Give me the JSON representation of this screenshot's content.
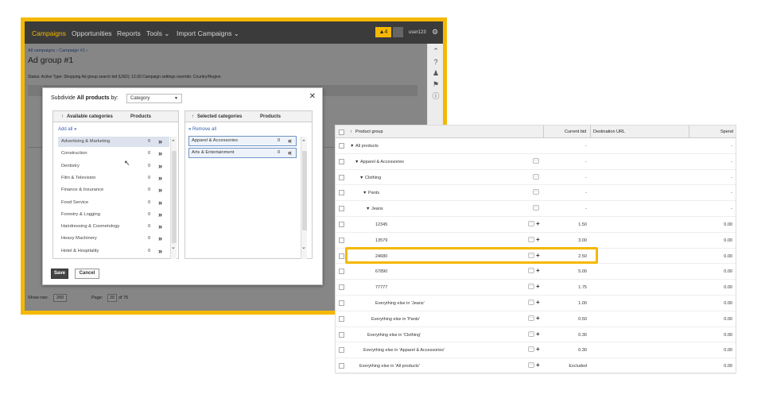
{
  "app": {
    "nav": [
      "Campaigns",
      "Opportunities",
      "Reports",
      "Tools ⌄",
      "Import Campaigns ⌄"
    ],
    "warning_count": "4",
    "user": "user123",
    "breadcrumb": "All campaigns › Campaign #1 ›",
    "page_title": "Ad group #1",
    "status_line": "Status: Active   Type: Shopping   Ad group search bid (USD): 12.00   Campaign settings override: Country/Region",
    "show_rows_label": "Show row:",
    "show_rows_value": "200",
    "page_label": "Page:",
    "page_value": "20",
    "page_of": "of 75"
  },
  "dialog": {
    "title_prefix": "Subdivide",
    "title_bold": "All products",
    "title_suffix": "by:",
    "dropdown_value": "Category",
    "available_header": "Available categories",
    "products_header": "Products",
    "add_all": "Add all",
    "available": [
      {
        "name": "Advertising & Marketing",
        "count": "0"
      },
      {
        "name": "Construction",
        "count": "0"
      },
      {
        "name": "Dentistry",
        "count": "0"
      },
      {
        "name": "Film & Television",
        "count": "0"
      },
      {
        "name": "Finance & Insurance",
        "count": "0"
      },
      {
        "name": "Food Service",
        "count": "0"
      },
      {
        "name": "Forestry & Logging",
        "count": "0"
      },
      {
        "name": "Hairdressing & Cosmetology",
        "count": "0"
      },
      {
        "name": "Heavy Machinery",
        "count": "0"
      },
      {
        "name": "Hotel & Hospitality",
        "count": "0"
      }
    ],
    "selected_header": "Selected categories",
    "remove_all": "Remove all",
    "selected": [
      {
        "name": "Apparel & Accessories",
        "count": "0"
      },
      {
        "name": "Arts & Entertainment",
        "count": "0"
      }
    ],
    "save": "Save",
    "cancel": "Cancel"
  },
  "table": {
    "headers": {
      "product_group": "Product group",
      "current_bid": "Current bid",
      "destination_url": "Destination URL",
      "spend": "Spend"
    },
    "rows": [
      {
        "group": "All products",
        "bid": "-",
        "spend": "-"
      },
      {
        "group": "Apparel & Accessories",
        "bid": "-",
        "spend": "-"
      },
      {
        "group": "Clothing",
        "bid": "-",
        "spend": "-"
      },
      {
        "group": "Pants",
        "bid": "-",
        "spend": "-"
      },
      {
        "group": "Jeans",
        "bid": "-",
        "spend": "-"
      },
      {
        "group": "12345",
        "bid": "1.50",
        "spend": "0.00"
      },
      {
        "group": "13579",
        "bid": "3.00",
        "spend": "0.00"
      },
      {
        "group": "24680",
        "bid": "2.50",
        "spend": "0.00"
      },
      {
        "group": "67890",
        "bid": "5.00",
        "spend": "0.00"
      },
      {
        "group": "77777",
        "bid": "1.75",
        "spend": "0.00"
      },
      {
        "group": "Everything else in 'Jeans'",
        "bid": "1.00",
        "spend": "0.00"
      },
      {
        "group": "Everything else in 'Pants'",
        "bid": "0.50",
        "spend": "0.00"
      },
      {
        "group": "Everything else in 'Clothing'",
        "bid": "0.30",
        "spend": "0.00"
      },
      {
        "group": "Everything else in 'Apparel & Accessories'",
        "bid": "0.30",
        "spend": "0.00"
      },
      {
        "group": "Everything else in 'All products'",
        "bid": "Excluded",
        "spend": "0.00"
      }
    ]
  },
  "colors": {
    "accent": "#f5b800",
    "link": "#3a64b0",
    "active_status": "#3a8d3a"
  }
}
